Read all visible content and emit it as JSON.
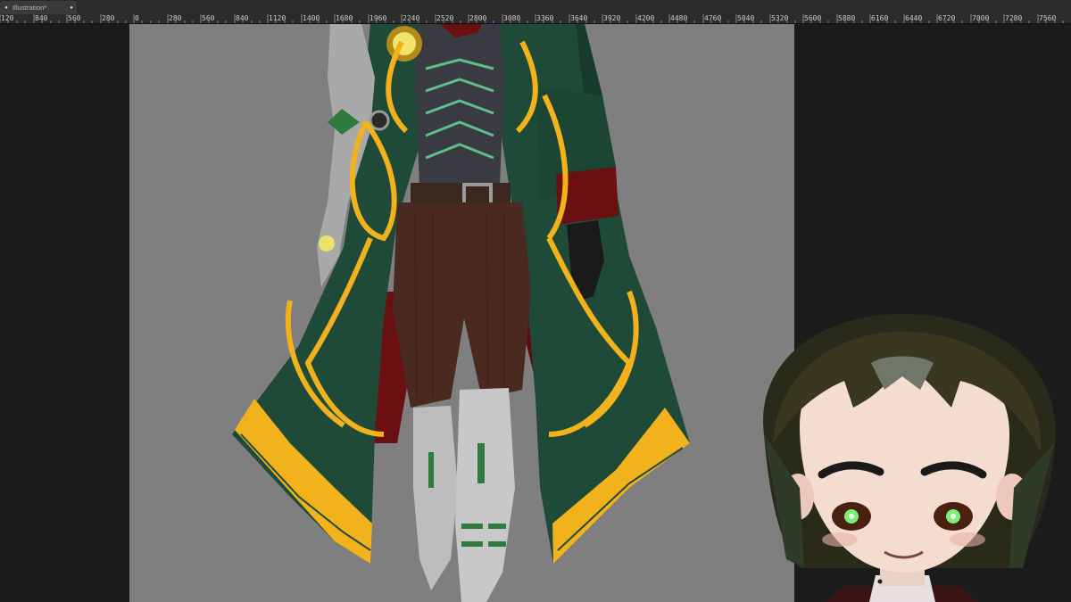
{
  "tab": {
    "title": "Illustration*",
    "pin_icon": "dot-icon",
    "close_icon": "dot-icon"
  },
  "ruler": {
    "labels": [
      "120",
      "840",
      "560",
      "280",
      "0",
      "280",
      "560",
      "840",
      "1120",
      "1400",
      "1680",
      "1960",
      "2240",
      "2520",
      "2800",
      "3080",
      "3360",
      "3640",
      "3920",
      "4200",
      "4480",
      "4760",
      "5040",
      "5320",
      "5600",
      "5880",
      "6160",
      "6440",
      "6720",
      "7000",
      "7280",
      "7560"
    ]
  },
  "colors": {
    "workspace": "#1b1b1b",
    "canvas": "#7f7f7f",
    "coat_green": "#1f4a38",
    "gold": "#f1b21b",
    "red": "#6a1010",
    "pants": "#4a2a20",
    "metal": "#bdbdbd",
    "skin": "#f4ddd0",
    "hair": "#2a2a1a"
  }
}
